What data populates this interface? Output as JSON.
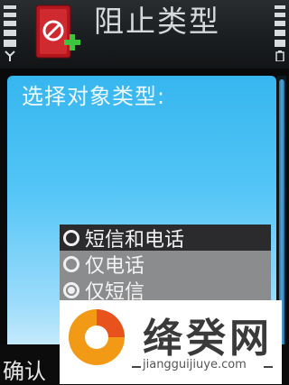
{
  "title_bar": {
    "title": "阻止类型",
    "app_icon": "block-add-icon",
    "signal_icon": "signal-strength-icon",
    "battery_icon": "battery-level-icon"
  },
  "dialog": {
    "prompt": "选择对象类型:",
    "options": [
      {
        "label": "短信和电话",
        "selected": true,
        "checked": false
      },
      {
        "label": "仅电话",
        "selected": false,
        "checked": false
      },
      {
        "label": "仅短信",
        "selected": false,
        "checked": true
      }
    ]
  },
  "softkeys": {
    "left": "确认"
  },
  "watermark": {
    "name": "绛癸网",
    "domain": "jiangguijiuye.com"
  },
  "colors": {
    "panel_top": "#36b6ef",
    "panel_bottom": "#d4effc",
    "title_text": "#d6d8d9",
    "selection_bg": "#2b2b2d",
    "list_bg": "#8a8c8e"
  }
}
